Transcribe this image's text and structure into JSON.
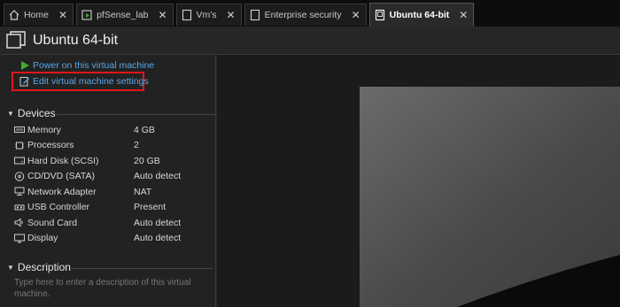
{
  "tabs": [
    {
      "label": "Home",
      "icon": "home-icon"
    },
    {
      "label": "pfSense_lab",
      "icon": "vm-running-icon"
    },
    {
      "label": "Vm's",
      "icon": "folder-icon"
    },
    {
      "label": "Enterprise security",
      "icon": "document-icon"
    },
    {
      "label": "Ubuntu 64-bit",
      "icon": "vm-icon",
      "active": true
    }
  ],
  "tab_close_glyph": "✕",
  "header": {
    "title": "Ubuntu 64-bit"
  },
  "actions": {
    "power_on": "Power on this virtual machine",
    "edit_settings": "Edit virtual machine settings"
  },
  "devices": {
    "title": "Devices",
    "items": [
      {
        "name": "Memory",
        "value": "4 GB",
        "icon": "memory-icon"
      },
      {
        "name": "Processors",
        "value": "2",
        "icon": "processor-icon"
      },
      {
        "name": "Hard Disk (SCSI)",
        "value": "20 GB",
        "icon": "hard-disk-icon"
      },
      {
        "name": "CD/DVD (SATA)",
        "value": "Auto detect",
        "icon": "cd-dvd-icon"
      },
      {
        "name": "Network Adapter",
        "value": "NAT",
        "icon": "network-adapter-icon"
      },
      {
        "name": "USB Controller",
        "value": "Present",
        "icon": "usb-icon"
      },
      {
        "name": "Sound Card",
        "value": "Auto detect",
        "icon": "speaker-icon"
      },
      {
        "name": "Display",
        "value": "Auto detect",
        "icon": "display-icon"
      }
    ]
  },
  "description": {
    "title": "Description",
    "placeholder": "Type here to enter a description of this virtual machine."
  },
  "colors": {
    "link": "#5aa7e6",
    "highlight": "#e0161c",
    "play": "#3fae2a"
  }
}
